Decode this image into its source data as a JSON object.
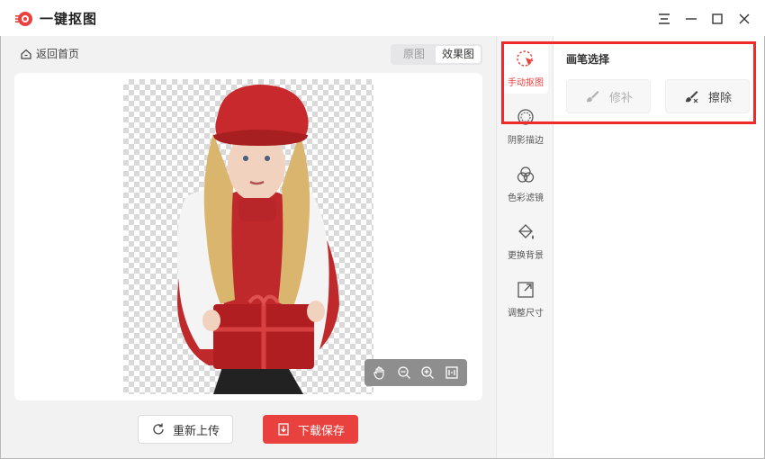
{
  "app": {
    "title": "一键抠图"
  },
  "window_controls": {
    "menu_icon": "menu-icon",
    "minimize_icon": "minimize-icon",
    "maximize_icon": "maximize-icon",
    "close_icon": "close-icon"
  },
  "workspace": {
    "back_label": "返回首页",
    "view_toggle": {
      "original_label": "原图",
      "result_label": "效果图",
      "selected": "效果图"
    },
    "zoom_tools": [
      "hand-icon",
      "zoom-out-icon",
      "zoom-in-icon",
      "fit-screen-icon"
    ],
    "reupload_label": "重新上传",
    "download_label": "下载保存"
  },
  "toolbar": {
    "items": [
      {
        "label": "手动抠图",
        "icon": "cursor-cut-icon",
        "active": true
      },
      {
        "label": "阴影描边",
        "icon": "shadow-outline-icon",
        "active": false
      },
      {
        "label": "色彩滤镜",
        "icon": "color-filter-icon",
        "active": false
      },
      {
        "label": "更换背景",
        "icon": "paint-bucket-icon",
        "active": false
      },
      {
        "label": "调整尺寸",
        "icon": "resize-icon",
        "active": false
      }
    ]
  },
  "panel": {
    "title": "画笔选择",
    "repair_label": "修补",
    "erase_label": "擦除"
  },
  "colors": {
    "accent": "#e8413e",
    "highlight": "#ee2b2b",
    "toolbar_bg": "#f5f5f6"
  }
}
